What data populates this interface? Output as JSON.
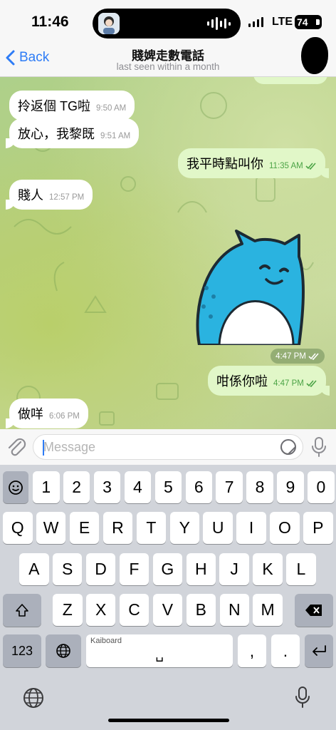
{
  "status_bar": {
    "time": "11:46",
    "network": "LTE",
    "battery": "74"
  },
  "nav": {
    "back_label": "Back",
    "title": "賤婢走數電話",
    "subtitle": "last seen within a month"
  },
  "messages": [
    {
      "dir": "in",
      "text": "拎返個 TG啦",
      "time": "9:50 AM"
    },
    {
      "dir": "in",
      "text": "放心，我黎既",
      "time": "9:51 AM"
    },
    {
      "dir": "out",
      "text": "我平時點叫你",
      "time": "11:35 AM"
    },
    {
      "dir": "in",
      "text": "賤人",
      "time": "12:57 PM"
    },
    {
      "dir": "out",
      "type": "sticker",
      "time": "4:47 PM"
    },
    {
      "dir": "out",
      "text": "咁係你啦",
      "time": "4:47 PM"
    },
    {
      "dir": "in",
      "text": "做咩",
      "time": "6:06 PM"
    }
  ],
  "input": {
    "placeholder": "Message"
  },
  "keyboard": {
    "row1": [
      "1",
      "2",
      "3",
      "4",
      "5",
      "6",
      "7",
      "8",
      "9",
      "0"
    ],
    "row2": [
      "Q",
      "W",
      "E",
      "R",
      "T",
      "Y",
      "U",
      "I",
      "O",
      "P"
    ],
    "row3": [
      "A",
      "S",
      "D",
      "F",
      "G",
      "H",
      "J",
      "K",
      "L"
    ],
    "row4": [
      "Z",
      "X",
      "C",
      "V",
      "B",
      "N",
      "M"
    ],
    "numbers_label": "123",
    "space_hint": "Kaiboard",
    "space_symbol": "␣",
    "comma": ",",
    "period": "."
  },
  "colors": {
    "accent": "#2e7cf6",
    "incoming_bubble": "#ffffff",
    "outgoing_bubble": "#e1f7c8",
    "read_check": "#4ca446"
  }
}
